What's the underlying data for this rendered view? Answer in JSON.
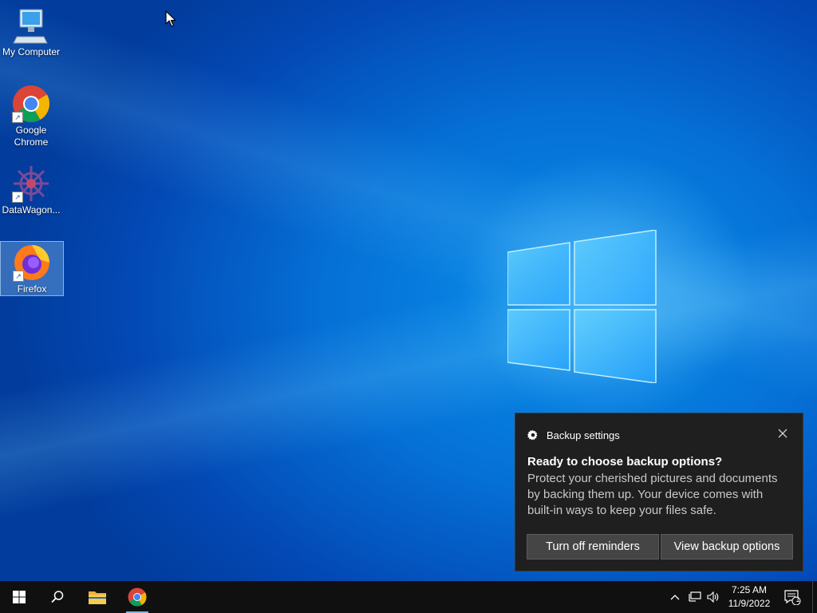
{
  "desktop": {
    "icons": [
      {
        "label": "My Computer",
        "icon": "computer-icon"
      },
      {
        "label": "Google Chrome",
        "line1": "Google",
        "line2": "Chrome",
        "icon": "chrome-icon"
      },
      {
        "label": "DataWagon...",
        "icon": "datawagon-icon"
      },
      {
        "label": "Firefox",
        "icon": "firefox-icon",
        "selected": true
      }
    ]
  },
  "toast": {
    "app_name": "Backup settings",
    "app_icon": "gear-icon",
    "title": "Ready to choose backup options?",
    "body": "Protect your cherished pictures and documents by backing them up. Your device comes with built-in ways to keep your files safe.",
    "buttons": {
      "turn_off": "Turn off reminders",
      "view": "View backup options"
    }
  },
  "taskbar": {
    "start_icon": "windows-start-icon",
    "search_icon": "search-icon",
    "pinned": [
      "file-explorer-icon",
      "chrome-icon"
    ],
    "tray_icons": [
      "chevron-up-icon",
      "network-icon",
      "volume-icon"
    ],
    "time": "7:25 AM",
    "date": "11/9/2022",
    "notification_count": "1"
  },
  "colors": {
    "accent": "#0570d6",
    "toast_bg": "#1f1f1f",
    "taskbar_bg": "#101010"
  }
}
